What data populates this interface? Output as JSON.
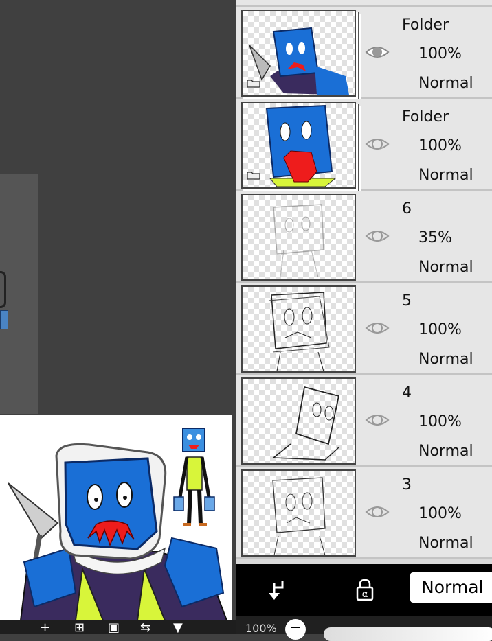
{
  "layers": [
    {
      "name": "Folder",
      "opacity": "100%",
      "blend": "Normal",
      "is_folder": true,
      "visible": true
    },
    {
      "name": "Folder",
      "opacity": "100%",
      "blend": "Normal",
      "is_folder": true,
      "visible": false
    },
    {
      "name": "6",
      "opacity": "35%",
      "blend": "Normal",
      "is_folder": false,
      "visible": false
    },
    {
      "name": "5",
      "opacity": "100%",
      "blend": "Normal",
      "is_folder": false,
      "visible": false
    },
    {
      "name": "4",
      "opacity": "100%",
      "blend": "Normal",
      "is_folder": false,
      "visible": false
    },
    {
      "name": "3",
      "opacity": "100%",
      "blend": "Normal",
      "is_folder": false,
      "visible": false
    }
  ],
  "layer_bar": {
    "clip_icon": "clip-down-arrow-icon",
    "alpha_lock_icon": "alpha-lock-icon",
    "blend_mode": "Normal"
  },
  "opacity_bar": {
    "label": "100%",
    "minus": "−"
  },
  "bottom_tools": [
    "+",
    "⊞",
    "▣",
    "⇆",
    "▼"
  ],
  "colors": {
    "panel_bg": "#e6e6e6",
    "workspace": "#404040",
    "character_blue": "#1a6fd6",
    "vest_yellow": "#d8f53a"
  }
}
